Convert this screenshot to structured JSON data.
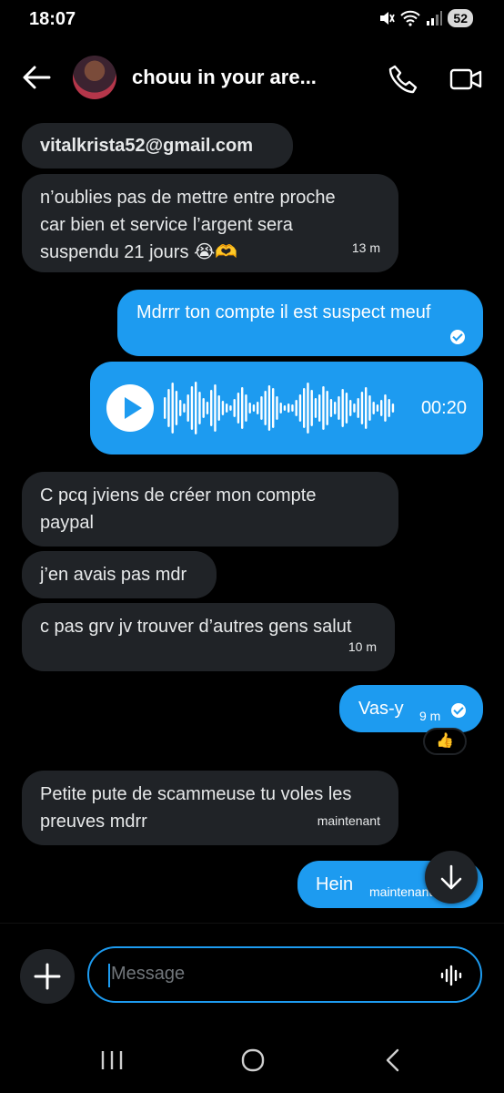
{
  "status": {
    "time": "18:07",
    "battery": "52"
  },
  "header": {
    "title": "chouu in your are..."
  },
  "messages": [
    {
      "id": "m1",
      "direction": "in",
      "text": "vitalkrista52@gmail.com",
      "time": ""
    },
    {
      "id": "m2",
      "direction": "in",
      "lines": [
        "n’oublies pas de mettre entre proche",
        "car bien et service l’argent sera",
        "suspendu 21 jours 😭🫶"
      ],
      "time": "13 m"
    },
    {
      "id": "m3",
      "direction": "out",
      "text": "Mdrrr ton compte il est suspect meuf",
      "time": ""
    },
    {
      "id": "m4",
      "direction": "out",
      "type": "voice",
      "duration": "00:20"
    },
    {
      "id": "m5",
      "direction": "in",
      "lines": [
        "C pcq jviens de créer mon compte",
        "paypal"
      ],
      "time": ""
    },
    {
      "id": "m6",
      "direction": "in",
      "text": "j’en avais pas mdr",
      "time": ""
    },
    {
      "id": "m7",
      "direction": "in",
      "text": "c pas grv jv trouver d’autres gens salut",
      "time": "10 m"
    },
    {
      "id": "m8",
      "direction": "out",
      "text": "Vas-y",
      "time": "9 m",
      "reaction": "👍"
    },
    {
      "id": "m9",
      "direction": "in",
      "lines": [
        "Petite pute de scammeuse tu voles les",
        "preuves mdrr"
      ],
      "time": "maintenant"
    },
    {
      "id": "m10",
      "direction": "out",
      "text": "Hein",
      "time": "maintenant"
    }
  ],
  "composer": {
    "placeholder": "Message"
  },
  "colors": {
    "accent": "#1d9bf0",
    "incoming_bubble": "#202327",
    "background": "#000000"
  }
}
